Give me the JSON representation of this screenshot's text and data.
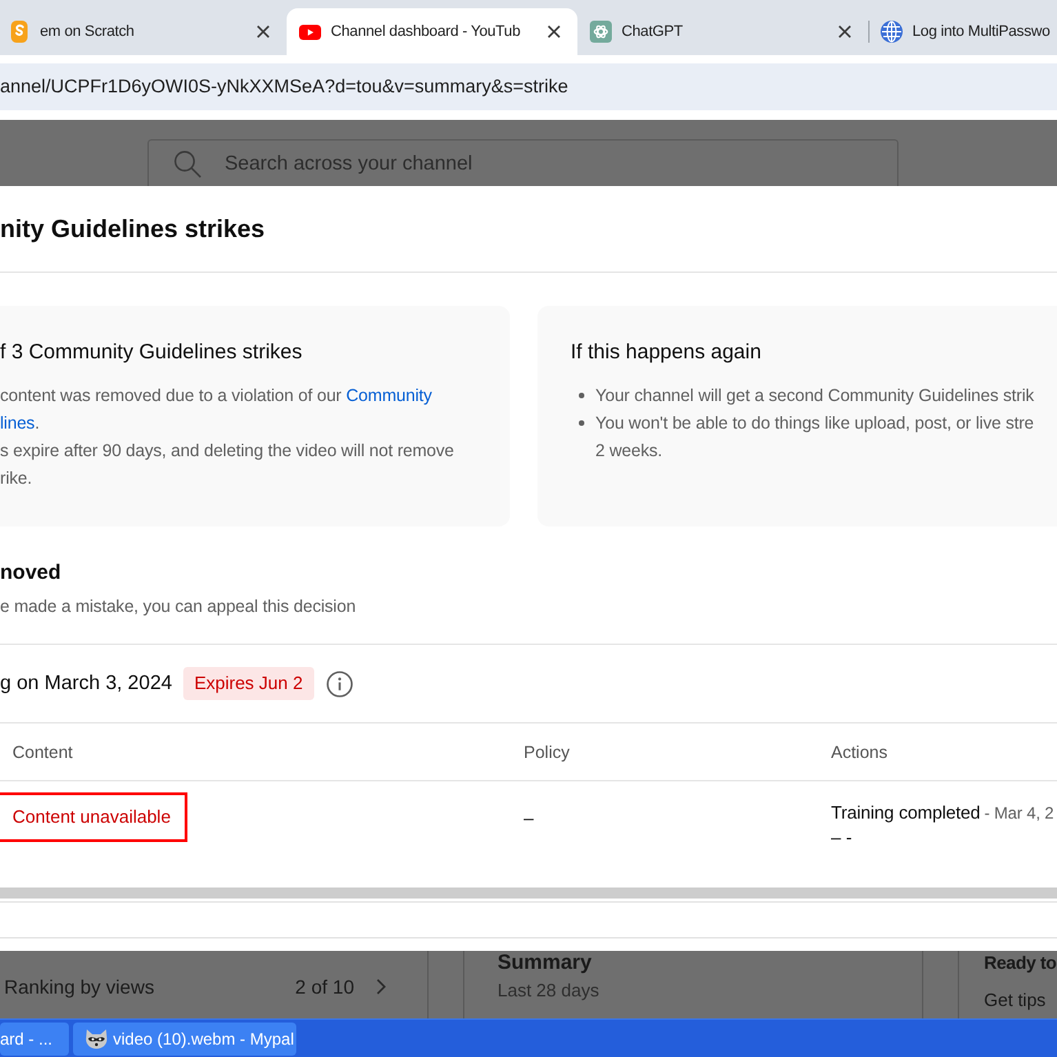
{
  "browser": {
    "tabs": [
      {
        "title": "em on Scratch",
        "kind": "scratch",
        "selected": false,
        "close_button": true
      },
      {
        "title": "Channel dashboard - YouTub",
        "kind": "youtube",
        "selected": true,
        "close_button": true
      },
      {
        "title": "ChatGPT",
        "kind": "chatgpt",
        "selected": false,
        "close_button": true
      },
      {
        "title": "Log into MultiPasswo",
        "kind": "globe",
        "selected": false,
        "close_button": false
      }
    ],
    "address": "annel/UCPFr1D6yOWI0S-yNkXXMSeA?d=tou&v=summary&s=strike"
  },
  "page": {
    "search": {
      "placeholder": "Search across your channel"
    },
    "ranking": {
      "label": "Ranking by views",
      "count": "2 of 10"
    },
    "summary": {
      "title": "Summary",
      "subtitle": "Last 28 days"
    },
    "tips": {
      "title": "Ready to",
      "subtitle": "Get tips"
    }
  },
  "dialog": {
    "title": "nity Guidelines strikes",
    "cards": [
      {
        "title": "f 3 Community Guidelines strikes",
        "bulleted": false,
        "items": [
          {
            "lines": [
              [
                {
                  "text": "content was removed due to a violation of our "
                },
                {
                  "text": "Community",
                  "link": true
                }
              ],
              [
                {
                  "text": "lines",
                  "link": true
                },
                {
                  "text": "."
                }
              ]
            ]
          },
          {
            "lines": [
              [
                {
                  "text": "s expire after 90 days, and deleting the video will not remove"
                }
              ],
              [
                {
                  "text": "rike."
                }
              ]
            ]
          }
        ]
      },
      {
        "title": "If this happens again",
        "bulleted": true,
        "items": [
          {
            "lines": [
              [
                {
                  "text": "Your channel will get a second Community Guidelines strik"
                }
              ]
            ]
          },
          {
            "lines": [
              [
                {
                  "text": "You won't be able to do things like upload, post, or live stre"
                }
              ],
              [
                {
                  "text": "2 weeks."
                }
              ]
            ]
          }
        ]
      }
    ],
    "removed": {
      "title": "noved",
      "text": "e made a mistake, you can appeal this decision"
    },
    "strike": {
      "date": "g on March 3, 2024",
      "badge": "Expires Jun 2"
    },
    "table": {
      "columns": [
        "Content",
        "Policy",
        "Actions"
      ],
      "rows": [
        {
          "content": "Content unavailable",
          "highlighted": true,
          "policy": "–",
          "action": "Training completed",
          "action_date": "- Mar 4, 2",
          "action_note": "– -"
        }
      ]
    }
  },
  "taskbar": {
    "items": [
      {
        "label": "ard - ...",
        "kind": "plain"
      },
      {
        "label": "video (10).webm - Mypal",
        "kind": "app"
      }
    ]
  }
}
